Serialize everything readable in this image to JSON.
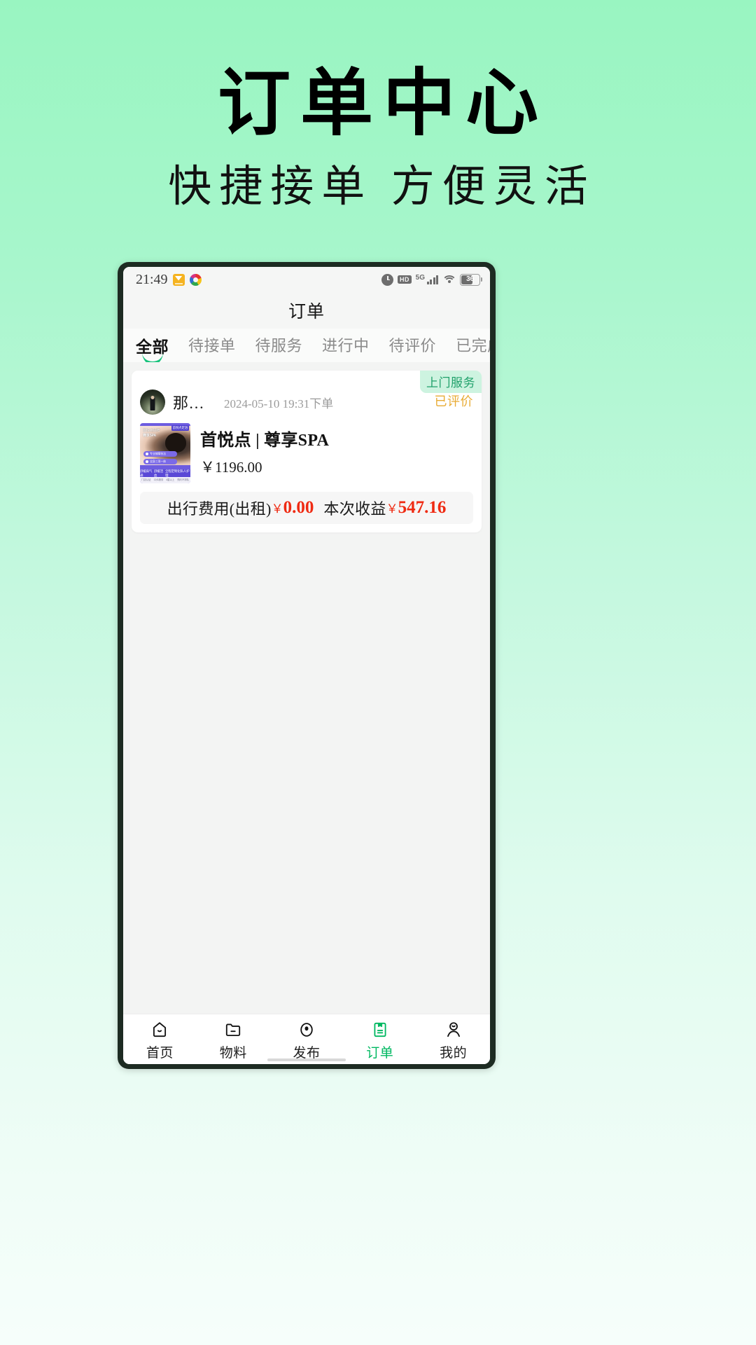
{
  "poster": {
    "headline": "订单中心",
    "subhead": "快捷接单 方便灵活",
    "background_top": "#99f5c1",
    "background_bottom": "#f6fefb"
  },
  "statusbar": {
    "time": "21:49",
    "icons_left": [
      "mail-app-icon",
      "colorful-app-icon"
    ],
    "icons_right": [
      "alarm-icon",
      "hd-icon",
      "5g-signal-icon",
      "wifi-icon",
      "battery-icon"
    ],
    "hd_label": "HD",
    "network_label": "5G",
    "battery_level": "36"
  },
  "header": {
    "title": "订单"
  },
  "tabs": [
    {
      "label": "全部",
      "active": true
    },
    {
      "label": "待接单",
      "active": false
    },
    {
      "label": "待服务",
      "active": false
    },
    {
      "label": "进行中",
      "active": false
    },
    {
      "label": "待评价",
      "active": false
    },
    {
      "label": "已完成",
      "active": false
    }
  ],
  "accent_color": "#19c37d",
  "order": {
    "service_badge": "上门服务",
    "username": "那…",
    "date": "2024-05-10 19:31下单",
    "status": "已评价",
    "status_color": "#e8ab34",
    "product_name": "首悦点 | 尊享SPA",
    "product_price": "￥1196.00",
    "thumb": {
      "title_small": "首悦点招牌",
      "title_main": "尊享SPA",
      "corner_tag": "首悦点足浴",
      "pill1": "专业按摩技法",
      "pill2": "全身三项一体",
      "bottom_tags": [
        "舒缓肩气通",
        "舒缓活血",
        "全程定制化私人护理"
      ],
      "foot_tags": [
        "门店认证",
        "1对1服务",
        "4星以上",
        "预约不排队"
      ]
    },
    "fee_label": "出行费用(出租)",
    "fee_currency": "￥",
    "fee_amount": "0.00",
    "income_label": "本次收益",
    "income_currency": "￥",
    "income_amount": "547.16",
    "amount_color": "#ef2a12"
  },
  "bottomnav": {
    "items": [
      {
        "label": "首页",
        "icon": "home-icon",
        "active": false
      },
      {
        "label": "物料",
        "icon": "folder-icon",
        "active": false
      },
      {
        "label": "发布",
        "icon": "publish-icon",
        "active": false
      },
      {
        "label": "订单",
        "icon": "order-icon",
        "active": true
      },
      {
        "label": "我的",
        "icon": "person-icon",
        "active": false
      }
    ],
    "active_color": "#00b861"
  }
}
